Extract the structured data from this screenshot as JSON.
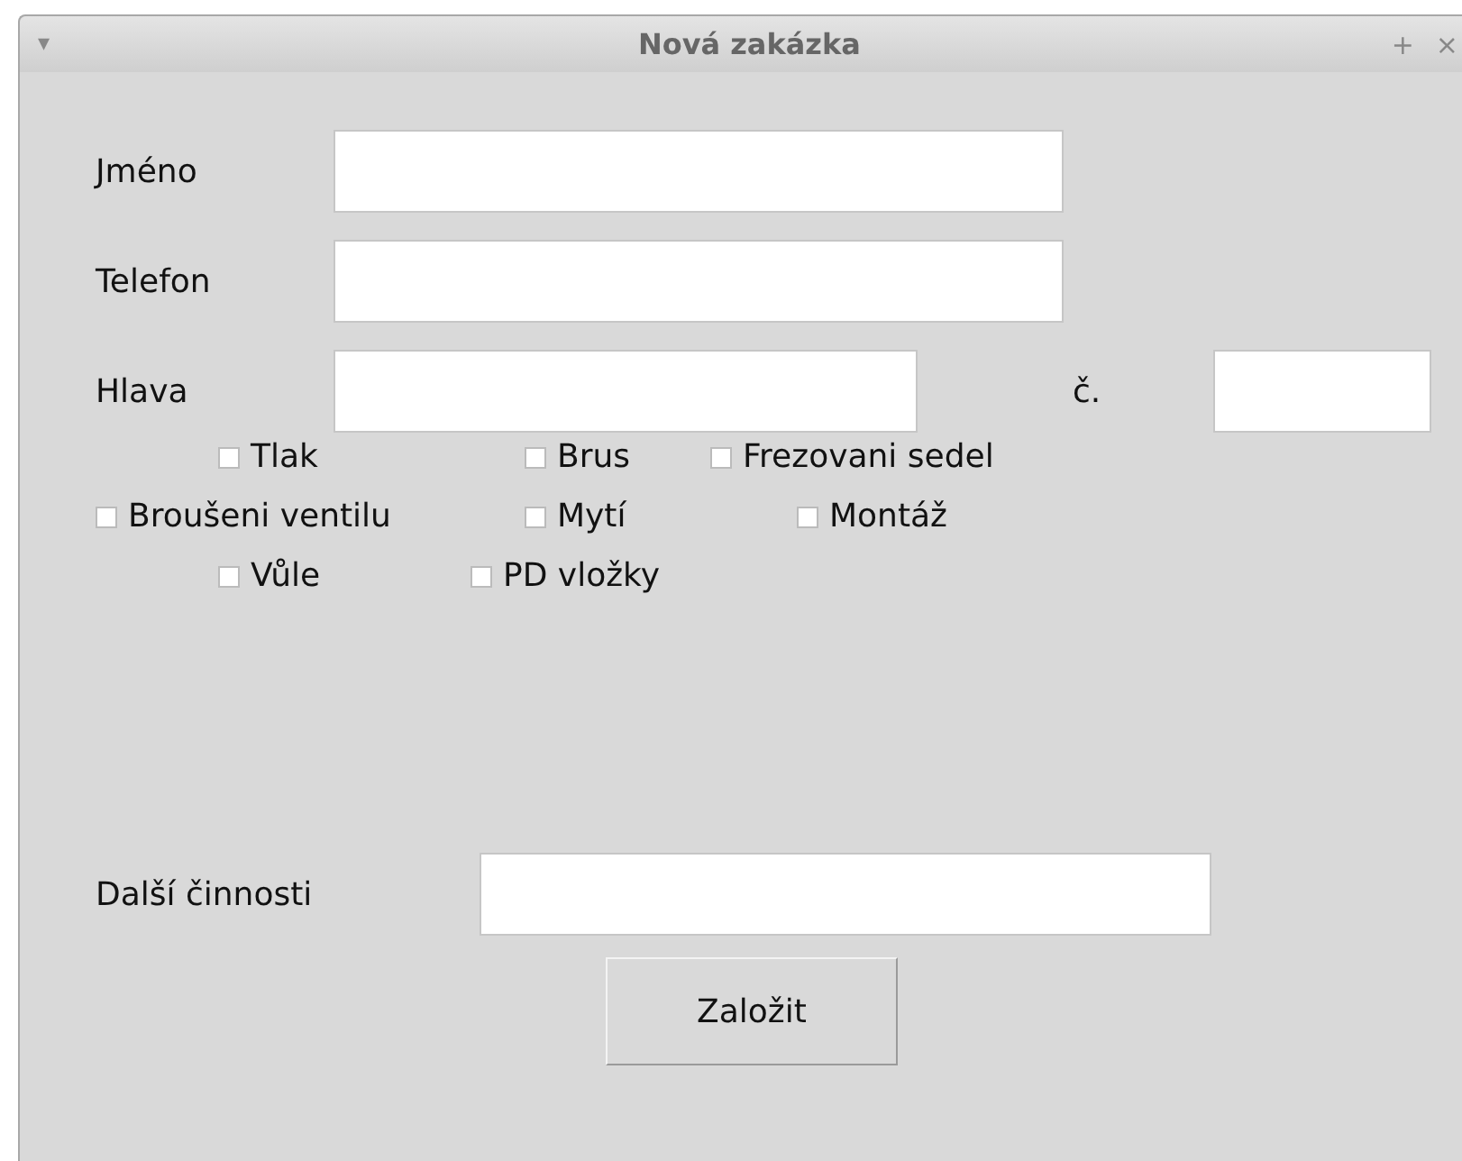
{
  "window": {
    "title": "Nová zakázka",
    "menu_glyph": "▾",
    "maximize_glyph": "+",
    "close_glyph": "×"
  },
  "fields": [
    {
      "label": "Jméno"
    },
    {
      "label": "Telefon"
    }
  ],
  "head": {
    "label": "Hlava",
    "number_label": "č."
  },
  "checkbox_rows": [
    [
      {
        "label": "Tlak",
        "checked": false
      },
      {
        "label": "Brus",
        "checked": false
      },
      {
        "label": "Frezovani sedel",
        "checked": false
      }
    ],
    [
      {
        "label": "Broušeni ventilu",
        "checked": false
      },
      {
        "label": "Mytí",
        "checked": false
      },
      {
        "label": "Montáž",
        "checked": false
      }
    ],
    [
      {
        "label": "Vůle",
        "checked": false
      },
      {
        "label": "PD vložky",
        "checked": false
      }
    ]
  ],
  "other": {
    "label": "Další činnosti"
  },
  "submit": "Založit"
}
